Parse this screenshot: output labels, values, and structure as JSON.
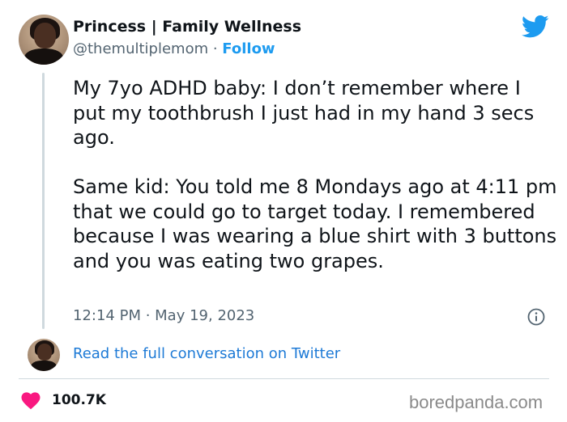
{
  "author": {
    "name": "Princess | Family Wellness",
    "handle": "@themultiplemom",
    "separator": " · ",
    "follow_label": "Follow"
  },
  "tweet": {
    "text": "My 7yo ADHD baby: I don’t remember where I put my toothbrush I just had in my hand 3 secs ago.\n\nSame kid: You told me 8 Mondays ago at 4:11 pm that we could go to target today. I remembered because I was wearing a blue shirt with 3 buttons and you was eating two grapes.",
    "time": "12:14 PM",
    "date_separator": " · ",
    "date": "May 19, 2023"
  },
  "conversation": {
    "link_text": "Read the full conversation on Twitter"
  },
  "engagement": {
    "likes": "100.7K"
  },
  "watermark": "boredpanda.com",
  "icons": {
    "brand": "twitter-bird-icon",
    "info": "info-icon",
    "like": "heart-icon"
  },
  "colors": {
    "accent": "#1d9bf0",
    "heart": "#f91880",
    "text": "#0f1419",
    "muted": "#536471"
  }
}
